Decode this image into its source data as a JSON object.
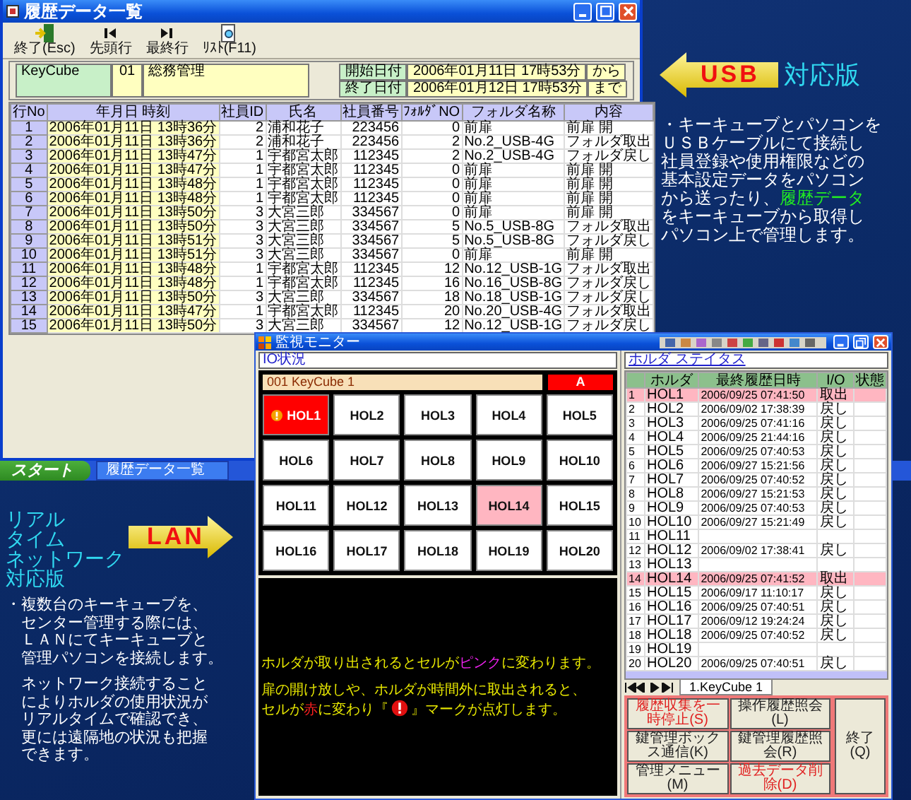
{
  "history_window": {
    "title": "履歴データ一覧",
    "toolbar": [
      {
        "label": "終了(Esc)",
        "kind": "exit"
      },
      {
        "label": "先頭行",
        "kind": "first"
      },
      {
        "label": "最終行",
        "kind": "last"
      },
      {
        "label": "ﾘｽﾄ(F11)",
        "kind": "list"
      }
    ],
    "filter": {
      "device": "KeyCube",
      "code": "01",
      "group": "総務管理",
      "start_label": "開始日付",
      "start": "2006年01月11日 17時53分",
      "start_suffix": "から",
      "end_label": "終了日付",
      "end": "2006年01月12日 17時53分",
      "end_suffix": "まで"
    },
    "table": {
      "columns": [
        "行No",
        "年月日 時刻",
        "社員ID",
        "氏名",
        "社員番号",
        "ﾌｫﾙﾀﾞNO",
        "フォルダ名称",
        "内容"
      ],
      "rows": [
        [
          "1",
          "2006年01月11日 13時36分",
          "2",
          "浦和花子",
          "223456",
          "0",
          "前扉",
          "前扉 開"
        ],
        [
          "2",
          "2006年01月11日 13時36分",
          "2",
          "浦和花子",
          "223456",
          "2",
          "No.2_USB-4G",
          "フォルダ取出"
        ],
        [
          "3",
          "2006年01月11日 13時47分",
          "1",
          "宇都宮太郎",
          "112345",
          "2",
          "No.2_USB-4G",
          "フォルダ戻し"
        ],
        [
          "4",
          "2006年01月11日 13時47分",
          "1",
          "宇都宮太郎",
          "112345",
          "0",
          "前扉",
          "前扉 開"
        ],
        [
          "5",
          "2006年01月11日 13時48分",
          "1",
          "宇都宮太郎",
          "112345",
          "0",
          "前扉",
          "前扉 開"
        ],
        [
          "6",
          "2006年01月11日 13時48分",
          "1",
          "宇都宮太郎",
          "112345",
          "0",
          "前扉",
          "前扉 開"
        ],
        [
          "7",
          "2006年01月11日 13時50分",
          "3",
          "大宮三郎",
          "334567",
          "0",
          "前扉",
          "前扉 開"
        ],
        [
          "8",
          "2006年01月11日 13時50分",
          "3",
          "大宮三郎",
          "334567",
          "5",
          "No.5_USB-8G",
          "フォルダ取出"
        ],
        [
          "9",
          "2006年01月11日 13時51分",
          "3",
          "大宮三郎",
          "334567",
          "5",
          "No.5_USB-8G",
          "フォルダ戻し"
        ],
        [
          "10",
          "2006年01月11日 13時51分",
          "3",
          "大宮三郎",
          "334567",
          "0",
          "前扉",
          "前扉 開"
        ],
        [
          "11",
          "2006年01月11日 13時48分",
          "1",
          "宇都宮太郎",
          "112345",
          "12",
          "No.12_USB-1G",
          "フォルダ取出"
        ],
        [
          "12",
          "2006年01月11日 13時48分",
          "1",
          "宇都宮太郎",
          "112345",
          "16",
          "No.16_USB-8G",
          "フォルダ戻し"
        ],
        [
          "13",
          "2006年01月11日 13時50分",
          "3",
          "大宮三郎",
          "334567",
          "18",
          "No.18_USB-1G",
          "フォルダ戻し"
        ],
        [
          "14",
          "2006年01月11日 13時47分",
          "1",
          "宇都宮太郎",
          "112345",
          "20",
          "No.20_USB-4G",
          "フォルダ取出"
        ],
        [
          "15",
          "2006年01月11日 13時50分",
          "3",
          "大宮三郎",
          "334567",
          "12",
          "No.12_USB-1G",
          "フォルダ戻し"
        ]
      ]
    }
  },
  "taskbar": {
    "start": "スタート",
    "tasks": [
      "履歴データ一覧"
    ]
  },
  "usb_callout": {
    "badge": "USB",
    "title": "対応版",
    "lines": [
      [
        {
          "text": "・キーキューブとパソコンを"
        }
      ],
      [
        {
          "text": "ＵＳＢケーブルにて接続し"
        }
      ],
      [
        {
          "text": "社員登録や使用権限などの"
        }
      ],
      [
        {
          "text": "基本設定データをパソコン"
        }
      ],
      [
        {
          "text": "から送ったり、"
        },
        {
          "text": "履歴データ",
          "color": "#22ee22"
        }
      ],
      [
        {
          "text": "をキーキューブから取得し"
        }
      ],
      [
        {
          "text": "パソコン上で管理します。"
        }
      ]
    ]
  },
  "lan_callout": {
    "title_lines": [
      "リアル",
      "タイム",
      "ネットワーク",
      "対応版"
    ],
    "badge": "LAN",
    "paragraphs": [
      [
        "・複数台のキーキューブを、",
        "センター管理する際には、",
        "ＬＡＮにてキーキューブと",
        "管理パソコンを接続します。"
      ],
      [
        "ネットワーク接続すること",
        "によりホルダの使用状況が",
        "リアルタイムで確認でき、",
        "更には遠隔地の状況も把握",
        "できます。"
      ]
    ]
  },
  "monitor_window": {
    "title": "監視モニター",
    "io_label": "IO状況",
    "unit_label": "001 KeyCube 1",
    "unit_alarm": "A",
    "holders": [
      {
        "name": "HOL1",
        "alarm": true
      },
      {
        "name": "HOL2",
        "out": false,
        "alarm": false
      },
      {
        "name": "HOL3",
        "out": false,
        "alarm": false
      },
      {
        "name": "HOL4",
        "out": false,
        "alarm": false
      },
      {
        "name": "HOL5",
        "out": false,
        "alarm": false
      },
      {
        "name": "HOL6",
        "out": false,
        "alarm": false
      },
      {
        "name": "HOL7",
        "out": false,
        "alarm": false
      },
      {
        "name": "HOL8",
        "out": false,
        "alarm": false
      },
      {
        "name": "HOL9",
        "out": false,
        "alarm": false
      },
      {
        "name": "HOL10",
        "out": false,
        "alarm": false
      },
      {
        "name": "HOL11",
        "out": false,
        "alarm": false
      },
      {
        "name": "HOL12",
        "out": false,
        "alarm": false
      },
      {
        "name": "HOL13",
        "out": false,
        "alarm": false
      },
      {
        "name": "HOL14",
        "out": true,
        "alarm": false
      },
      {
        "name": "HOL15",
        "out": false,
        "alarm": false
      },
      {
        "name": "HOL16",
        "out": false,
        "alarm": false
      },
      {
        "name": "HOL17",
        "out": false,
        "alarm": false
      },
      {
        "name": "HOL18",
        "out": false,
        "alarm": false
      },
      {
        "name": "HOL19",
        "out": false,
        "alarm": false
      },
      {
        "name": "HOL20",
        "out": false,
        "alarm": false
      }
    ],
    "message": [
      [
        {
          "text": "ホルダが取り出されるとセルが"
        },
        {
          "text": "ピンク",
          "color": "#ee22ee"
        },
        {
          "text": "に変わります。"
        }
      ],
      [
        {
          "text": "扉の開け放しや、ホルダが時間外に取出されると、"
        }
      ],
      [
        {
          "text": "セルが"
        },
        {
          "text": "赤",
          "color": "#ff2020"
        },
        {
          "text": "に変わり『"
        },
        {
          "kind": "alarm_mark"
        },
        {
          "text": "』マークが点灯します。"
        }
      ]
    ],
    "status_label": "ホルダ ステイタス",
    "status_columns": [
      "ホルダ",
      "最終履歴日時",
      "I/O",
      "状態"
    ],
    "status_rows": [
      {
        "no": "1",
        "holder": "HOL1",
        "time": "2006/09/25 07:41:50",
        "io": "取出",
        "out": true
      },
      {
        "no": "2",
        "holder": "HOL2",
        "time": "2006/09/02 17:38:39",
        "io": "戻し",
        "out": false
      },
      {
        "no": "3",
        "holder": "HOL3",
        "time": "2006/09/25 07:41:16",
        "io": "戻し",
        "out": false
      },
      {
        "no": "4",
        "holder": "HOL4",
        "time": "2006/09/25 21:44:16",
        "io": "戻し",
        "out": false
      },
      {
        "no": "5",
        "holder": "HOL5",
        "time": "2006/09/25 07:40:53",
        "io": "戻し",
        "out": false
      },
      {
        "no": "6",
        "holder": "HOL6",
        "time": "2006/09/27 15:21:56",
        "io": "戻し",
        "out": false
      },
      {
        "no": "7",
        "holder": "HOL7",
        "time": "2006/09/25 07:40:52",
        "io": "戻し",
        "out": false
      },
      {
        "no": "8",
        "holder": "HOL8",
        "time": "2006/09/27 15:21:53",
        "io": "戻し",
        "out": false
      },
      {
        "no": "9",
        "holder": "HOL9",
        "time": "2006/09/25 07:40:53",
        "io": "戻し",
        "out": false
      },
      {
        "no": "10",
        "holder": "HOL10",
        "time": "2006/09/27 15:21:49",
        "io": "戻し",
        "out": false
      },
      {
        "no": "11",
        "holder": "HOL11",
        "out": false
      },
      {
        "no": "12",
        "holder": "HOL12",
        "time": "2006/09/02 17:38:41",
        "io": "戻し",
        "out": false
      },
      {
        "no": "13",
        "holder": "HOL13",
        "out": false
      },
      {
        "no": "14",
        "holder": "HOL14",
        "time": "2006/09/25 07:41:52",
        "io": "取出",
        "out": true
      },
      {
        "no": "15",
        "holder": "HOL15",
        "time": "2006/09/17 11:10:17",
        "io": "戻し",
        "out": false
      },
      {
        "no": "16",
        "holder": "HOL16",
        "time": "2006/09/25 07:40:51",
        "io": "戻し",
        "out": false
      },
      {
        "no": "17",
        "holder": "HOL17",
        "time": "2006/09/12 19:24:24",
        "io": "戻し",
        "out": false
      },
      {
        "no": "18",
        "holder": "HOL18",
        "time": "2006/09/25 07:40:52",
        "io": "戻し",
        "out": false
      },
      {
        "no": "19",
        "holder": "HOL19",
        "out": false
      },
      {
        "no": "20",
        "holder": "HOL20",
        "time": "2006/09/25 07:40:51",
        "io": "戻し",
        "out": false
      }
    ],
    "sheet_tab": "1.KeyCube 1",
    "buttons": [
      {
        "label": "履歴収集を一時停止(S)",
        "kind": "warning"
      },
      {
        "label": "操作履歴照会(L)",
        "kind": "normal"
      },
      {
        "label": "鍵管理ボックス通信(K)",
        "kind": "normal"
      },
      {
        "label": "鍵管理履歴照会(R)",
        "kind": "normal"
      },
      {
        "label": "管理メニュー(M)",
        "kind": "normal"
      },
      {
        "label": "過去データ削除(D)",
        "kind": "warning"
      }
    ],
    "close_button": "終了(Q)"
  }
}
